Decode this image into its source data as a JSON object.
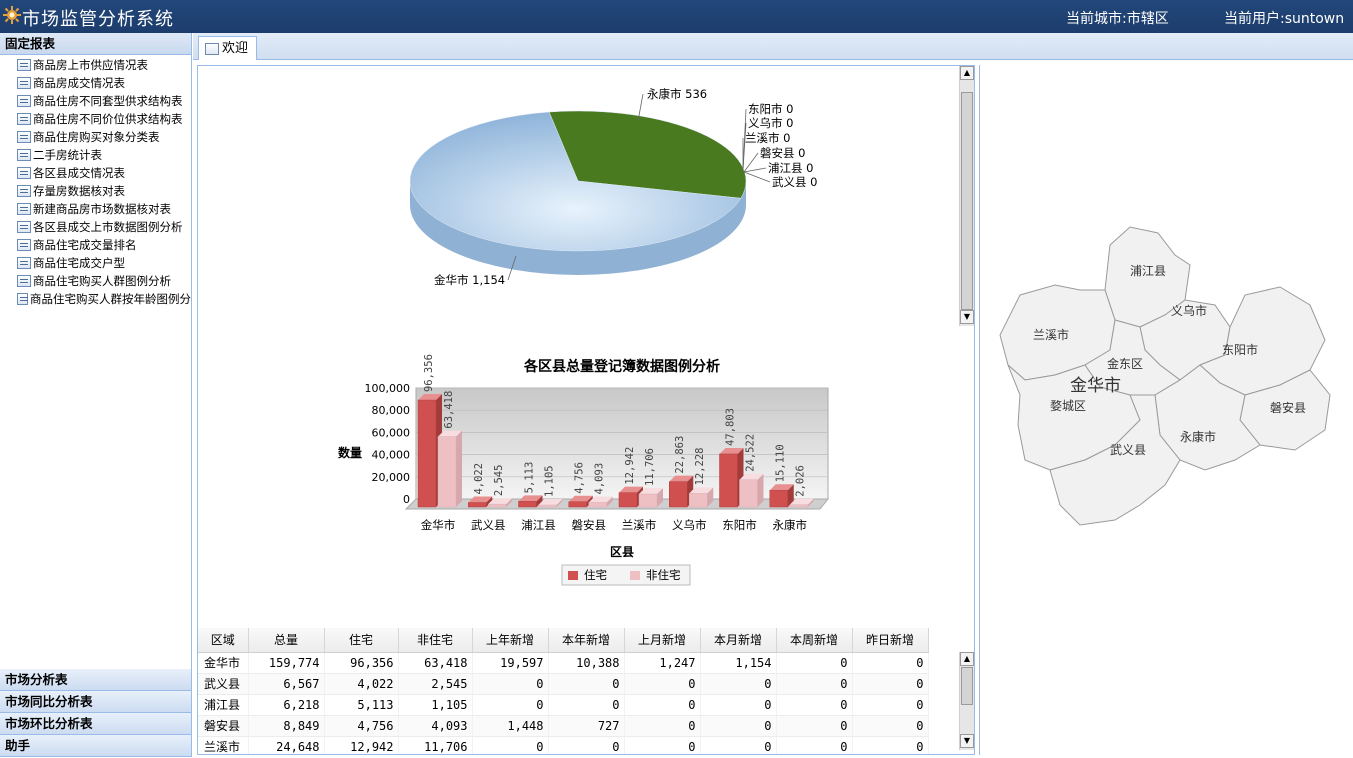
{
  "header": {
    "app_title": "市场监管分析系统",
    "current_city": "当前城市:市辖区",
    "current_user": "当前用户:suntown"
  },
  "sidebar": {
    "fixed_reports_label": "固定报表",
    "items": [
      "商品房上市供应情况表",
      "商品房成交情况表",
      "商品住房不同套型供求结构表",
      "商品住房不同价位供求结构表",
      "商品住房购买对象分类表",
      "二手房统计表",
      "各区县成交情况表",
      "存量房数据核对表",
      "新建商品房市场数据核对表",
      "各区县成交上市数据图例分析",
      "商品住宅成交量排名",
      "商品住宅成交户型",
      "商品住宅购买人群图例分析",
      "商品住宅购买人群按年龄图例分"
    ],
    "bottom_sections": [
      "市场分析表",
      "市场同比分析表",
      "市场环比分析表",
      "助手"
    ]
  },
  "tabs": {
    "welcome": "欢迎"
  },
  "colors": {
    "header_bg": "#1f4273",
    "pie_green": "#4a7a1f",
    "pie_blue": "#a8c8e8",
    "bar_red": "#d9534f",
    "bar_pink": "#f0c8cc"
  },
  "chart_data": [
    {
      "type": "pie",
      "title": "",
      "slices": [
        {
          "label": "永康市",
          "value": 536,
          "display": "536"
        },
        {
          "label": "东阳市",
          "value": 0,
          "display": "0"
        },
        {
          "label": "义乌市",
          "value": 0,
          "display": "0"
        },
        {
          "label": "兰溪市",
          "value": 0,
          "display": "0"
        },
        {
          "label": "磐安县",
          "value": 0,
          "display": "0"
        },
        {
          "label": "浦江县",
          "value": 0,
          "display": "0"
        },
        {
          "label": "武义县",
          "value": 0,
          "display": "0"
        },
        {
          "label": "金华市",
          "value": 1154,
          "display": "1,154"
        }
      ]
    },
    {
      "type": "bar",
      "title": "各区县总量登记簿数据图例分析",
      "xlabel": "区县",
      "ylabel": "数量",
      "ylim": [
        0,
        100000
      ],
      "yticks": [
        "100,000",
        "80,000",
        "60,000",
        "40,000",
        "20,000",
        "0"
      ],
      "categories": [
        "金华市",
        "武义县",
        "浦江县",
        "磐安县",
        "兰溪市",
        "义乌市",
        "东阳市",
        "永康市"
      ],
      "series": [
        {
          "name": "住宅",
          "values": [
            96356,
            4022,
            5113,
            4756,
            12942,
            22863,
            47803,
            15110
          ],
          "labels": [
            "96,356",
            "4,022",
            "5,113",
            "4,756",
            "12,942",
            "22,863",
            "47,803",
            "15,110"
          ]
        },
        {
          "name": "非住宅",
          "values": [
            63418,
            2545,
            1105,
            4093,
            11706,
            12228,
            24522,
            2026
          ],
          "labels": [
            "63,418",
            "2,545",
            "1,105",
            "4,093",
            "11,706",
            "12,228",
            "24,522",
            "2,026"
          ]
        }
      ],
      "legend_position": "bottom"
    }
  ],
  "table": {
    "columns": [
      "区域",
      "总量",
      "住宅",
      "非住宅",
      "上年新增",
      "本年新增",
      "上月新增",
      "本月新增",
      "本周新增",
      "昨日新增"
    ],
    "rows": [
      [
        "金华市",
        "159,774",
        "96,356",
        "63,418",
        "19,597",
        "10,388",
        "1,247",
        "1,154",
        "0",
        "0"
      ],
      [
        "武义县",
        "6,567",
        "4,022",
        "2,545",
        "0",
        "0",
        "0",
        "0",
        "0",
        "0"
      ],
      [
        "浦江县",
        "6,218",
        "5,113",
        "1,105",
        "0",
        "0",
        "0",
        "0",
        "0",
        "0"
      ],
      [
        "磐安县",
        "8,849",
        "4,756",
        "4,093",
        "1,448",
        "727",
        "0",
        "0",
        "0",
        "0"
      ],
      [
        "兰溪市",
        "24,648",
        "12,942",
        "11,706",
        "0",
        "0",
        "0",
        "0",
        "0",
        "0"
      ]
    ]
  },
  "map": {
    "labels": [
      "浦江县",
      "义乌市",
      "兰溪市",
      "东阳市",
      "金东区",
      "金华市",
      "婺城区",
      "磐安县",
      "武义县",
      "永康市"
    ]
  }
}
